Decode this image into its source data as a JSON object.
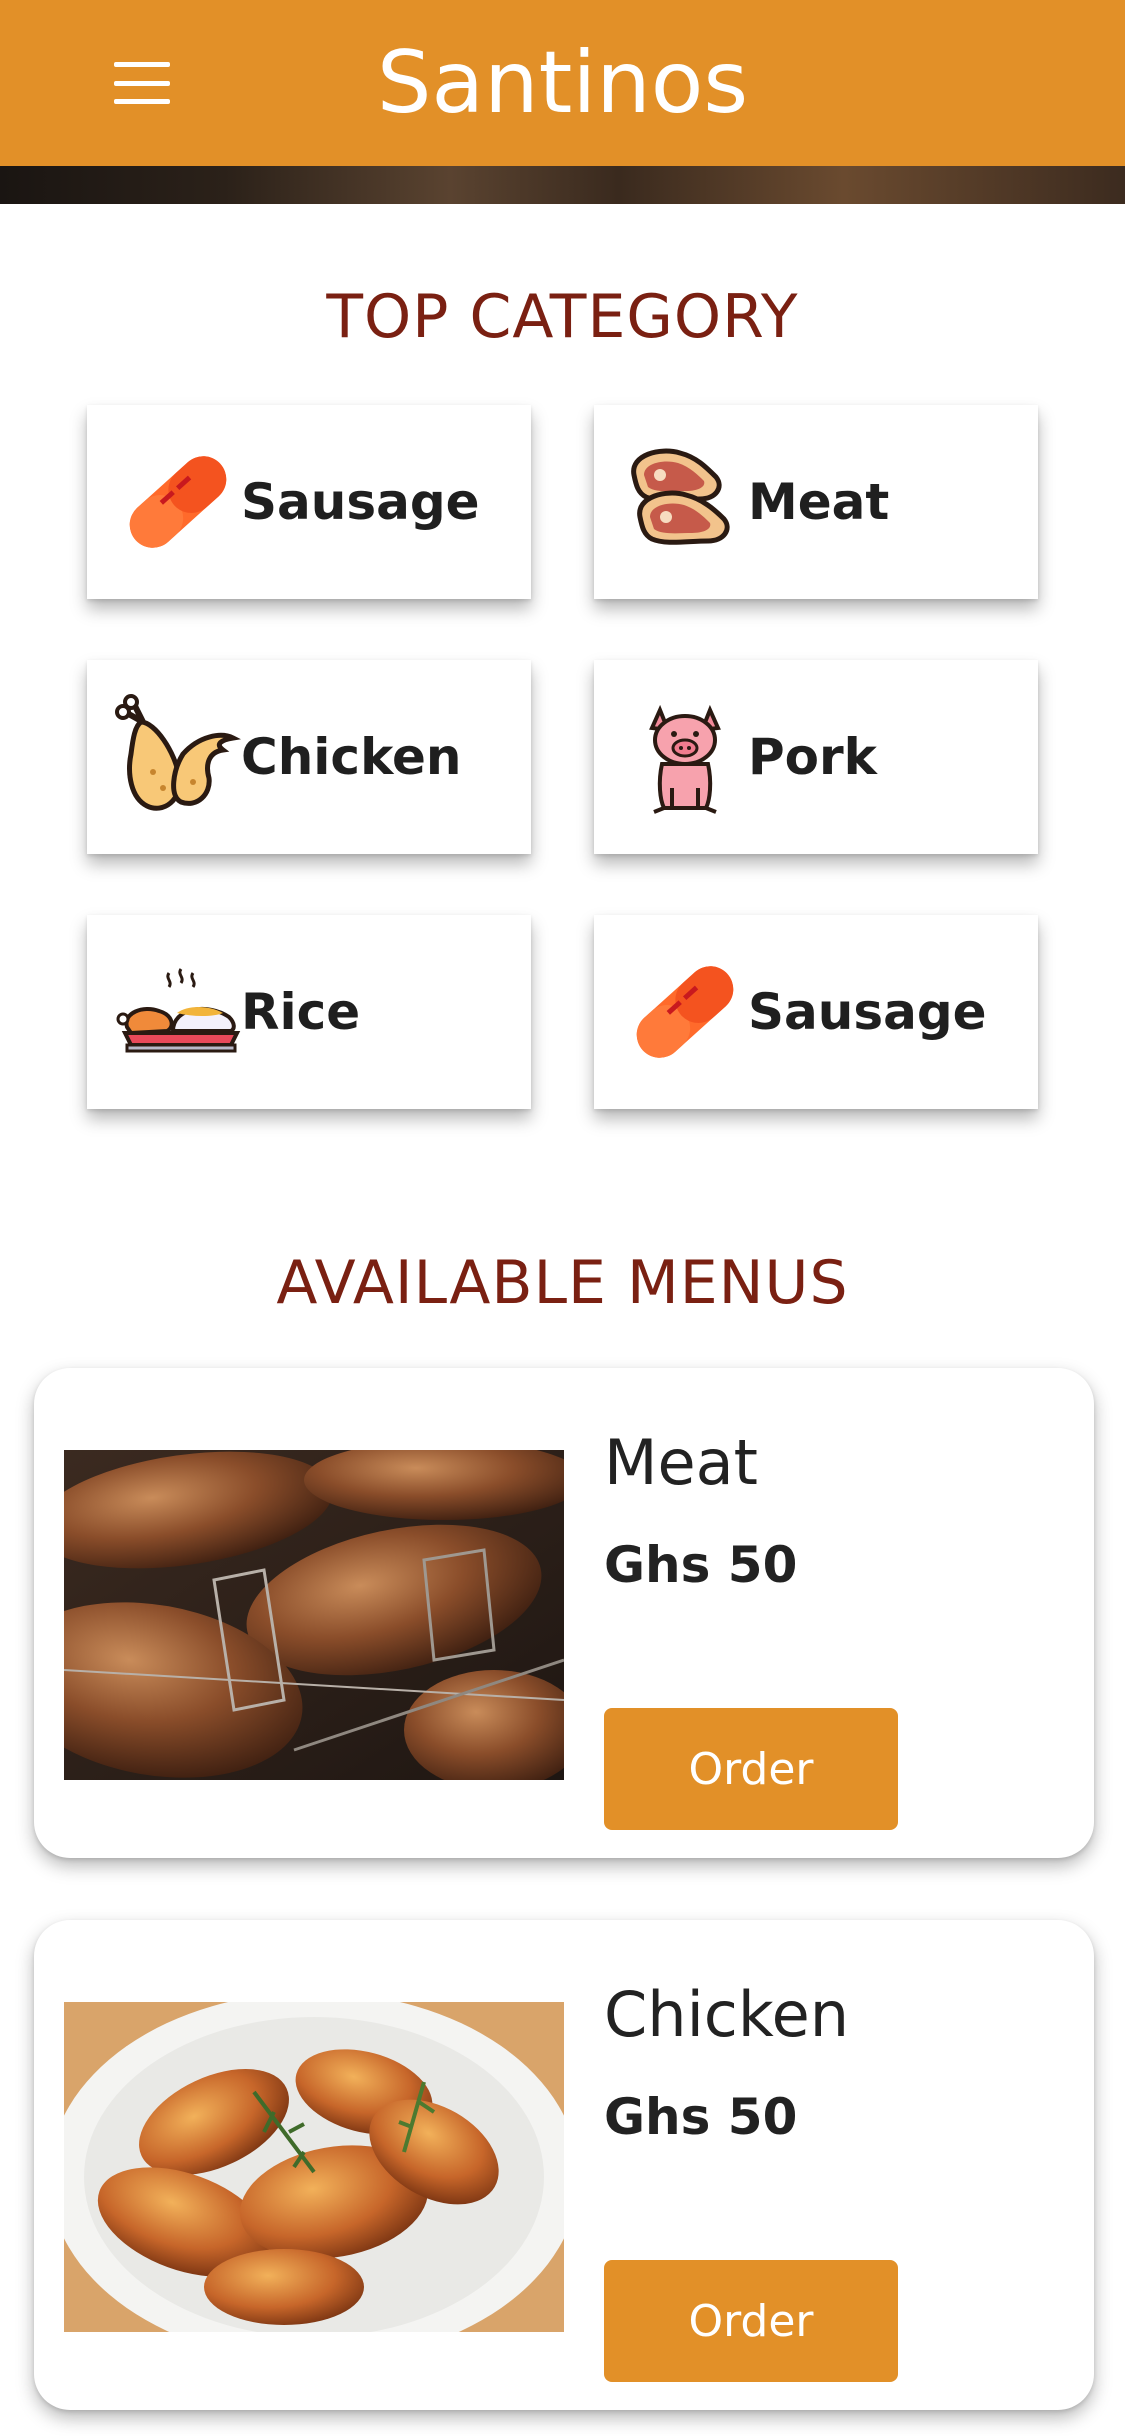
{
  "header": {
    "title": "Santinos",
    "menu_icon": "hamburger-menu-icon",
    "background": "#e29028"
  },
  "top_category": {
    "title": "TOP CATEGORY",
    "items": [
      {
        "label": "Sausage",
        "icon": "sausage-icon"
      },
      {
        "label": "Meat",
        "icon": "steak-icon"
      },
      {
        "label": "Chicken",
        "icon": "chicken-leg-icon"
      },
      {
        "label": "Pork",
        "icon": "pig-icon"
      },
      {
        "label": "Rice",
        "icon": "rice-plate-icon"
      },
      {
        "label": "Sausage",
        "icon": "sausage-icon"
      }
    ]
  },
  "available_menus": {
    "title": "AVAILABLE MENUS",
    "items": [
      {
        "name": "Meat",
        "price": "Ghs 50",
        "order_label": "Order",
        "image": "grilled-meat-photo"
      },
      {
        "name": "Chicken",
        "price": "Ghs 50",
        "order_label": "Order",
        "image": "chicken-wings-photo"
      }
    ]
  },
  "colors": {
    "accent": "#e29028",
    "section_title": "#7a2012"
  }
}
